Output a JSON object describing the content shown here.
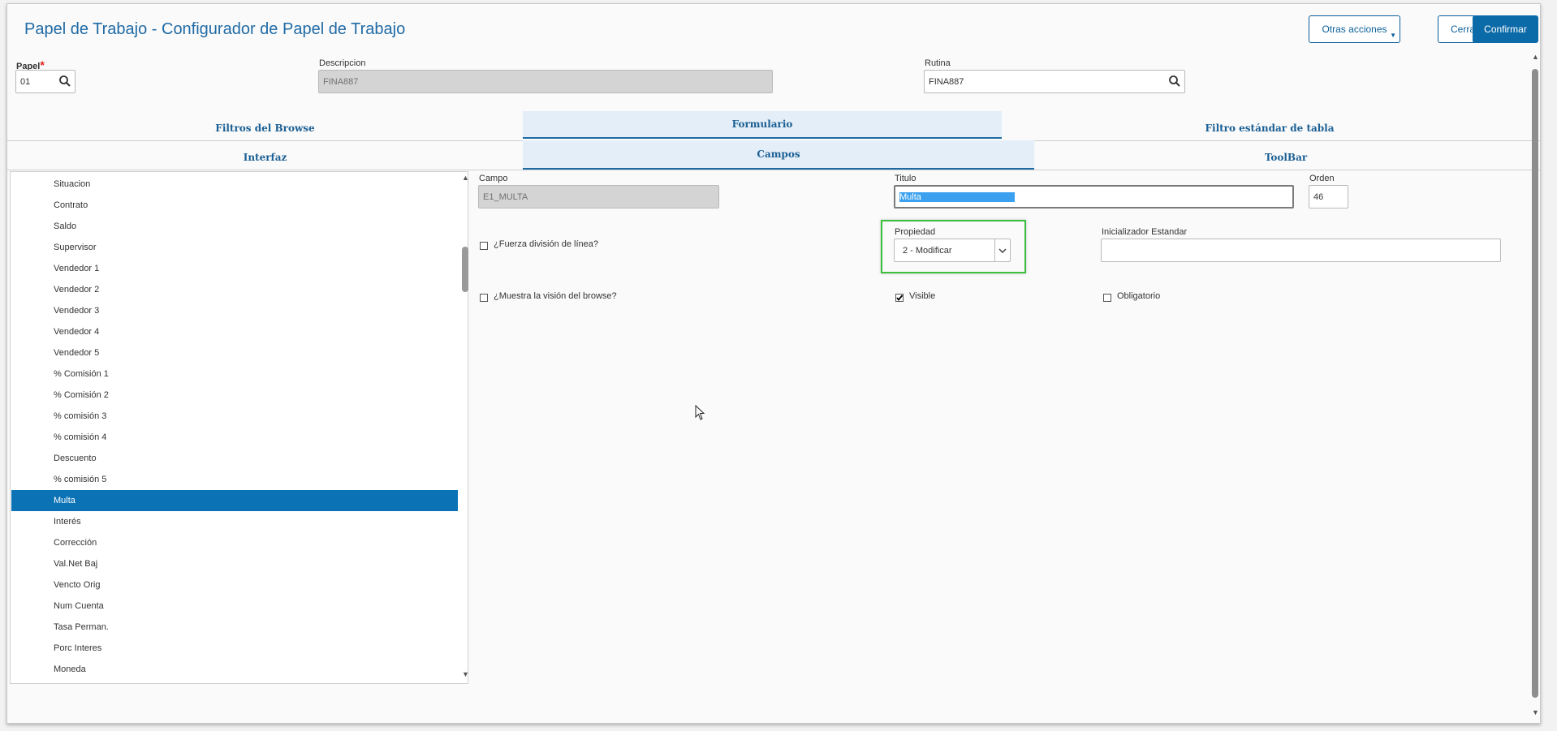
{
  "header": {
    "title": "Papel de Trabajo - Configurador de Papel de Trabajo",
    "btn_more": "Otras acciones",
    "btn_close": "Cerrar",
    "btn_confirm": "Confirmar"
  },
  "fields": {
    "papel_label": "Papel",
    "papel_required": "*",
    "papel_value": "01",
    "descripcion_label": "Descripcion",
    "descripcion_value": "FINA887",
    "rutina_label": "Rutina",
    "rutina_value": "FINA887"
  },
  "tabs_top": [
    "Filtros del Browse",
    "Formulario",
    "Filtro estándar de tabla"
  ],
  "tabs_sub": [
    "Interfaz",
    "Campos",
    "ToolBar"
  ],
  "active_top_tab": "Formulario",
  "active_sub_tab": "Campos",
  "field_list": [
    "Situacion",
    "Contrato",
    "Saldo",
    "Supervisor",
    "Vendedor 1",
    "Vendedor 2",
    "Vendedor 3",
    "Vendedor 4",
    "Vendedor 5",
    "% Comisión 1",
    "% Comisión 2",
    "% comisión 3",
    "% comisión 4",
    "Descuento",
    "% comisión 5",
    "Multa",
    "Interés",
    "Corrección",
    "Val.Net Baj",
    "Vencto Orig",
    "Num Cuenta",
    "Tasa Perman.",
    "Porc Interes",
    "Moneda"
  ],
  "selected_field": "Multa",
  "detail": {
    "campo_label": "Campo",
    "campo_value": "E1_MULTA",
    "titulo_label": "Titulo",
    "titulo_value": "Multa",
    "orden_label": "Orden",
    "orden_value": "46",
    "fuerza_label": "¿Fuerza división de línea?",
    "fuerza_checked": false,
    "propiedad_label": "Propiedad",
    "propiedad_value": "2 - Modificar",
    "inicializador_label": "Inicializador Estandar",
    "inicializador_value": "",
    "muestra_label": "¿Muestra la visión del browse?",
    "muestra_checked": false,
    "visible_label": "Visible",
    "visible_checked": true,
    "obligatorio_label": "Obligatorio",
    "obligatorio_checked": false
  },
  "colors": {
    "accent": "#1f6aa5",
    "selected_row": "#0b73b5",
    "highlight_border": "#3cbf3c",
    "text_selection": "#3aa0ef"
  }
}
